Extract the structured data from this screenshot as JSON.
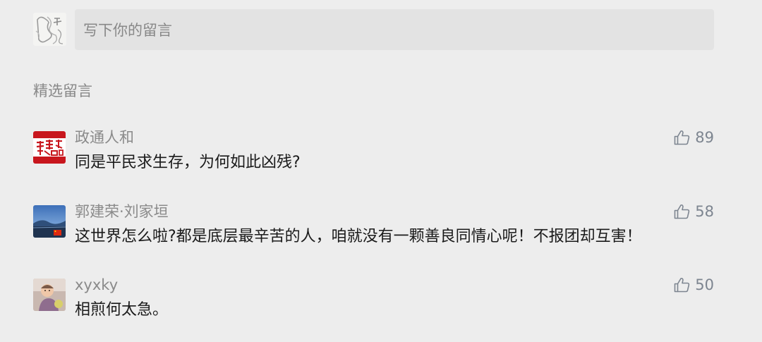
{
  "composer": {
    "placeholder": "写下你的留言"
  },
  "section_title": "精选留言",
  "comments": [
    {
      "author": "政通人和",
      "text": "同是平民求生存，为何如此凶残?",
      "likes": "89",
      "avatar_icon": "red-calligraphy-avatar"
    },
    {
      "author": "郭建荣·刘家垣",
      "text": "这世界怎么啦?都是底层最辛苦的人，咱就没有一颗善良同情心呢！不报团却互害！",
      "likes": "58",
      "avatar_icon": "landscape-flag-avatar"
    },
    {
      "author": "xyxky",
      "text": "相煎何太急。",
      "likes": "50",
      "avatar_icon": "child-photo-avatar"
    }
  ],
  "colors": {
    "background": "#ededed",
    "input_background": "#e3e3e3",
    "meta_text": "#888888",
    "body_text": "#1a1a1a",
    "like_color": "#7d8590"
  }
}
